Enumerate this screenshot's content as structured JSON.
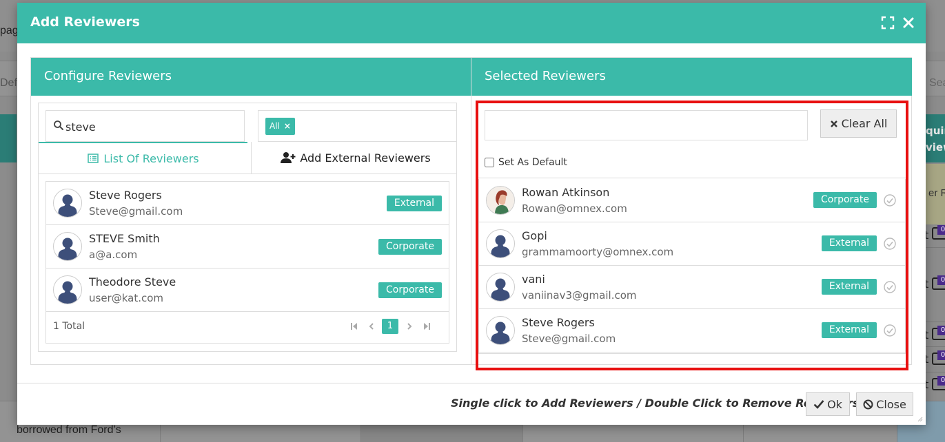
{
  "background": {
    "page_fragment": "pag",
    "default_fragment": "Defa",
    "search_fragment": "Sea",
    "header_fragment": "quire\nview",
    "row_fragment": "er R",
    "cell_fragment": "t",
    "chat_count": "0",
    "bottom_text": "borrowed from Ford’s"
  },
  "modal": {
    "title": "Add Reviewers",
    "icons": {
      "expand": "expand-icon",
      "close": "close-icon"
    }
  },
  "configure": {
    "title": "Configure Reviewers",
    "search_value": "steve",
    "filter_chip": "All",
    "tabs": [
      {
        "label": "List Of Reviewers",
        "icon": "list-icon",
        "active": true
      },
      {
        "label": "Add External Reviewers",
        "icon": "user-plus-icon",
        "active": false
      }
    ],
    "people": [
      {
        "name": "Steve Rogers",
        "email": "Steve@gmail.com",
        "type": "External"
      },
      {
        "name": "STEVE Smith",
        "email": "a@a.com",
        "type": "Corporate"
      },
      {
        "name": "Theodore Steve",
        "email": "user@kat.com",
        "type": "Corporate"
      }
    ],
    "total": "1 Total",
    "current_page": "1"
  },
  "selected": {
    "title": "Selected Reviewers",
    "search_value": "",
    "clear_all_label": "Clear All",
    "set_default_label": "Set As Default",
    "set_default_checked": false,
    "people": [
      {
        "name": "Rowan Atkinson",
        "email": "Rowan@omnex.com",
        "type": "Corporate",
        "avatar": "photo"
      },
      {
        "name": "Gopi",
        "email": "grammamoorty@omnex.com",
        "type": "External",
        "avatar": "default"
      },
      {
        "name": "vani",
        "email": "vaniinav3@gmail.com",
        "type": "External",
        "avatar": "default"
      },
      {
        "name": "Steve Rogers",
        "email": "Steve@gmail.com",
        "type": "External",
        "avatar": "default"
      }
    ]
  },
  "footer": {
    "hint": "Single click to Add Reviewers / Double Click to Remove Reviewers",
    "ok_label": "Ok",
    "close_label": "Close"
  },
  "colors": {
    "accent": "#3bbaa9",
    "highlight": "#e81010",
    "avatar_figure": "#3d4f7a"
  }
}
